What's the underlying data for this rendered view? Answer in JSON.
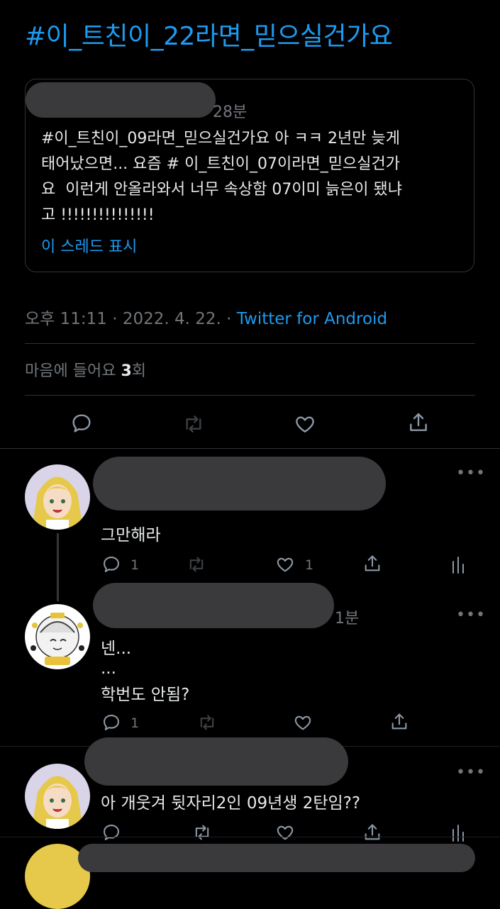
{
  "tweet": {
    "hashtag_text": "#이_트친이_22라면_믿으실건가요",
    "timestamp": "오후 11:11 · 2022. 4. 22. · ",
    "source": "Twitter for Android",
    "likes_label_prefix": "마음에 들어요 ",
    "likes_count": "3",
    "likes_label_suffix": "회"
  },
  "quote": {
    "time": "28분",
    "text": "#이_트친이_09라면_믿으실건가요 아 ㅋㅋ 2년만 늦게\n태어났으면... 요즘 # 이_트친이_07이라면_믿으실건가\n요  이런게 안올라와서 너무 속상함 07이미 늙은이 됐냐\n고 !!!!!!!!!!!!!!!",
    "show_thread": "이 스레드 표시"
  },
  "replies": [
    {
      "time": "",
      "text": "그만해라",
      "reply_count": "1",
      "retweet_count": "",
      "like_count": "1"
    },
    {
      "time": "1분",
      "text_line1": "넨...",
      "text_line2": "...",
      "text_line3": "학번도 안됨?",
      "reply_count": "1",
      "retweet_count": "",
      "like_count": ""
    },
    {
      "time": "",
      "text": "아 개웃겨 뒷자리2인 09년생 2탄임??"
    }
  ],
  "more_label": "•••",
  "colors": {
    "accent": "#1d9bf0",
    "muted": "#71767b",
    "text": "#e7e9ea",
    "border": "#2f3336",
    "redaction": "#3a3a3c"
  },
  "icons": [
    "reply-icon",
    "retweet-icon",
    "like-icon",
    "share-icon",
    "analytics-icon",
    "more-icon"
  ]
}
